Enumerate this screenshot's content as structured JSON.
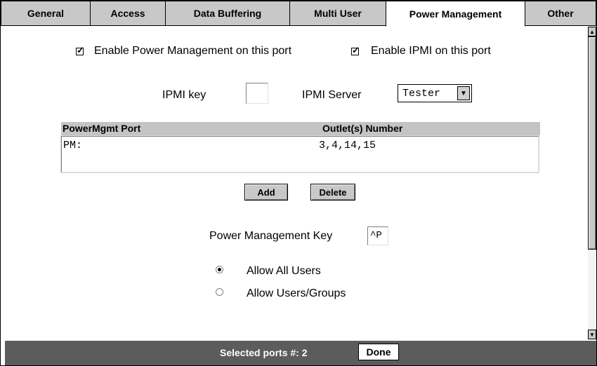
{
  "tabs": [
    {
      "label": "General"
    },
    {
      "label": "Access"
    },
    {
      "label": "Data Buffering"
    },
    {
      "label": "Multi User"
    },
    {
      "label": "Power Management"
    },
    {
      "label": "Other"
    }
  ],
  "active_tab": "Power Management",
  "options": {
    "enable_power_mgmt": {
      "label": "Enable Power Management on this port",
      "checked": true
    },
    "enable_ipmi": {
      "label": "Enable IPMI on this port",
      "checked": true
    }
  },
  "ipmi": {
    "key_label": "IPMI key",
    "key_value": "",
    "server_label": "IPMI Server",
    "server_value": "Tester"
  },
  "outlet_table": {
    "headers": [
      "PowerMgmt Port",
      "Outlet(s) Number"
    ],
    "rows": [
      {
        "port": "PM:",
        "outlets": "3,4,14,15"
      }
    ]
  },
  "buttons": {
    "add": "Add",
    "delete": "Delete",
    "done": "Done"
  },
  "pm_key": {
    "label": "Power Management Key",
    "value": "^P"
  },
  "access": {
    "options": [
      {
        "label": "Allow All Users",
        "selected": true
      },
      {
        "label": "Allow Users/Groups",
        "selected": false
      }
    ]
  },
  "status": {
    "text": "Selected ports #: 2"
  }
}
